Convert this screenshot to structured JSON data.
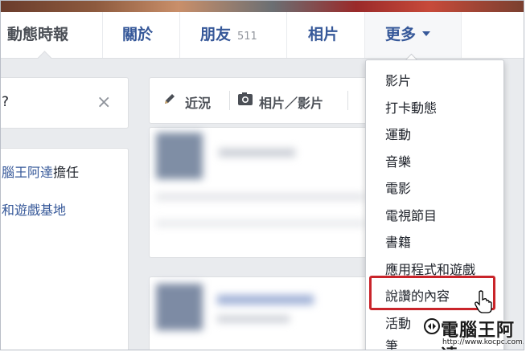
{
  "nav": {
    "timeline": "動態時報",
    "about": "關於",
    "friends": "朋友",
    "friends_count": "511",
    "photos": "相片",
    "more": "更多"
  },
  "sidebar": {
    "partial_text": "?",
    "line1_link": "腦王阿達",
    "line1_rest": "擔任",
    "line2": "和遊戲基地"
  },
  "composer": {
    "status_tab": "近況",
    "photo_tab": "相片／影片"
  },
  "more_menu": {
    "items": [
      "影片",
      "打卡動態",
      "運動",
      "音樂",
      "電影",
      "電視節目",
      "書籍",
      "應用程式和遊戲",
      "說讚的內容",
      "活動",
      "筆"
    ]
  },
  "watermark": {
    "brand": "電腦王阿達",
    "url": "http://www.kocpc.com.tw"
  },
  "colors": {
    "link": "#365899",
    "highlight": "#c9242a",
    "page_bg": "#e9ebee"
  }
}
